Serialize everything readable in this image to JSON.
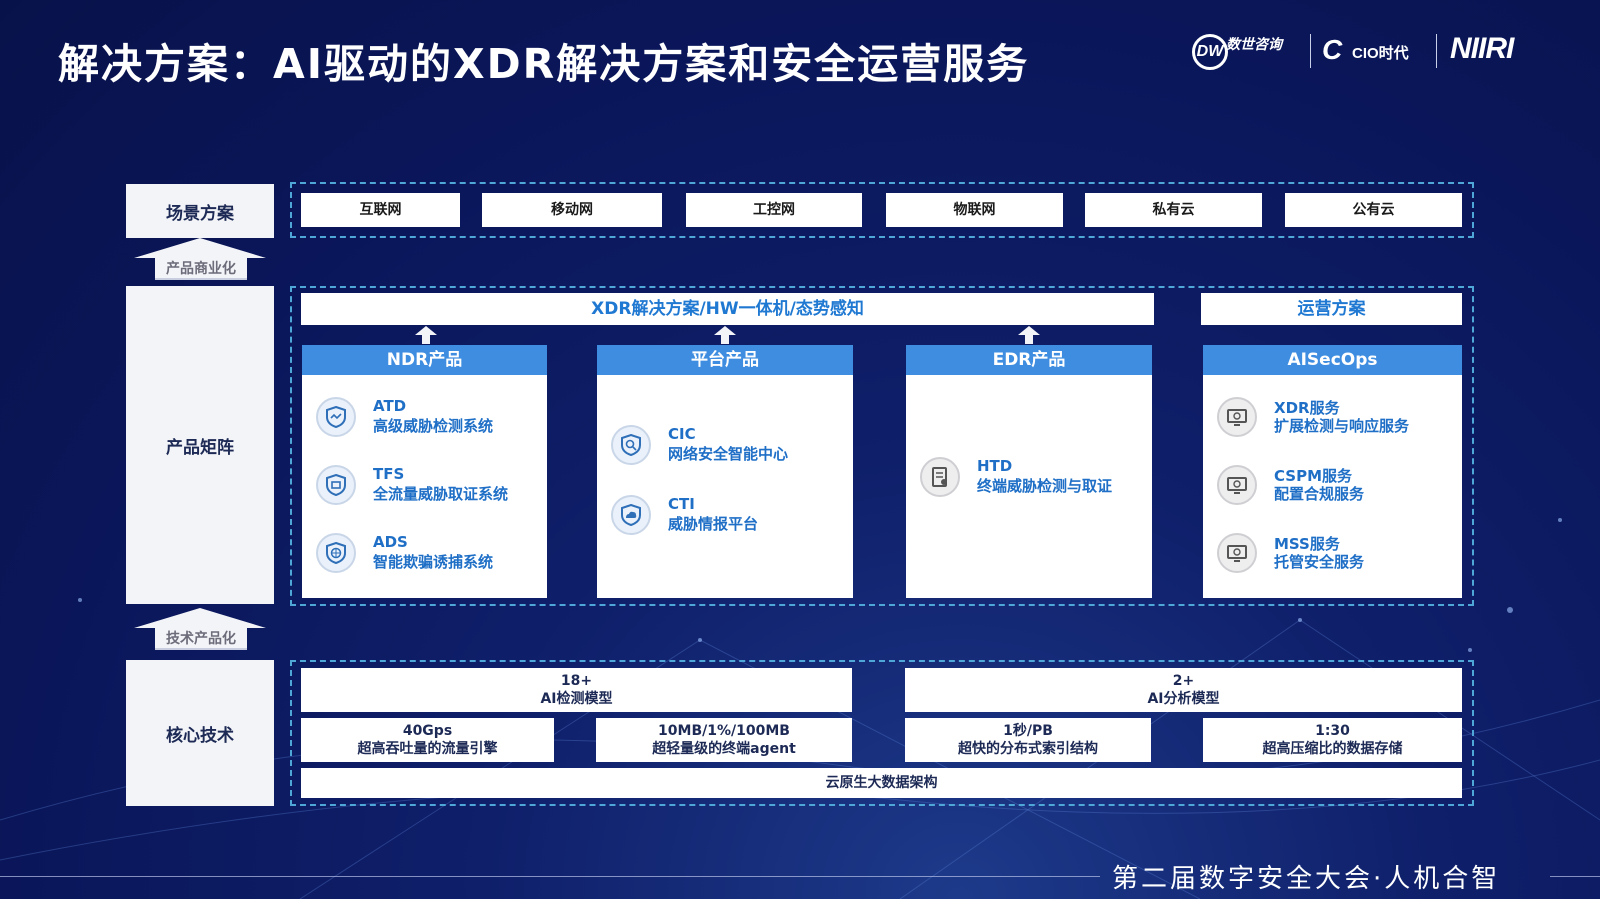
{
  "title": "解决方案：AI驱动的XDR解决方案和安全运营服务",
  "logos": {
    "dw": {
      "mark": "DW",
      "text": "数世咨询"
    },
    "cio": {
      "mark": "C",
      "text": "CIO时代"
    },
    "niiri": {
      "text": "NIIRI"
    }
  },
  "left_column": {
    "scene": "场景方案",
    "commercialize": "产品商业化",
    "matrix": "产品矩阵",
    "productize": "技术产品化",
    "core": "核心技术"
  },
  "scenes": [
    "互联网",
    "移动网",
    "工控网",
    "物联网",
    "私有云",
    "公有云"
  ],
  "matrix": {
    "xdr_bar": "XDR解决方案/HW一体机/态势感知",
    "ops_bar": "运营方案",
    "ndr": {
      "title": "NDR产品",
      "items": [
        {
          "name": "ATD",
          "desc": "高级威胁检测系统",
          "icon": "shield-icon"
        },
        {
          "name": "TFS",
          "desc": "全流量威胁取证系统",
          "icon": "shield-icon"
        },
        {
          "name": "ADS",
          "desc": "智能欺骗诱捕系统",
          "icon": "globe-shield-icon"
        }
      ]
    },
    "platform": {
      "title": "平台产品",
      "items": [
        {
          "name": "CIC",
          "desc": "网络安全智能中心",
          "icon": "shield-search-icon"
        },
        {
          "name": "CTI",
          "desc": "威胁情报平台",
          "icon": "cloud-shield-icon"
        }
      ]
    },
    "edr": {
      "title": "EDR产品",
      "items": [
        {
          "name": "HTD",
          "desc": "终端威胁检测与取证",
          "icon": "device-icon"
        }
      ]
    },
    "aisecops": {
      "title": "AISecOps",
      "items": [
        {
          "name": "XDR服务",
          "desc": "扩展检测与响应服务",
          "icon": "monitor-icon"
        },
        {
          "name": "CSPM服务",
          "desc": "配置合规服务",
          "icon": "monitor-icon"
        },
        {
          "name": "MSS服务",
          "desc": "托管安全服务",
          "icon": "monitor-icon"
        }
      ]
    }
  },
  "core_tech": {
    "ai_detect": {
      "value": "18+",
      "label": "AI检测模型"
    },
    "ai_analysis": {
      "value": "2+",
      "label": "AI分析模型"
    },
    "traffic": {
      "value": "40Gps",
      "label": "超高吞吐量的流量引擎"
    },
    "agent": {
      "value": "10MB/1%/100MB",
      "label": "超轻量级的终端agent"
    },
    "index": {
      "value": "1秒/PB",
      "label": "超快的分布式索引结构"
    },
    "storage": {
      "value": "1:30",
      "label": "超高压缩比的数据存储"
    },
    "cloud": "云原生大数据架构"
  },
  "footer": "第二届数字安全大会·人机合智",
  "colors": {
    "accent": "#3f8de0",
    "text_blue": "#1f6fc7",
    "background": "#0a1659"
  }
}
